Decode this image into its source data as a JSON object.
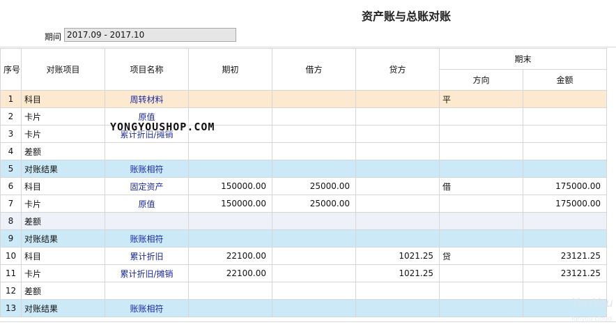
{
  "title": "资产账与总账对账",
  "period": {
    "label": "期间",
    "value": "2017.09 - 2017.10"
  },
  "columns": {
    "seq": "序号",
    "item": "对账项目",
    "name": "项目名称",
    "opening": "期初",
    "debit": "借方",
    "credit": "贷方",
    "ending": "期末",
    "direction": "方向",
    "amount": "金额"
  },
  "rows": [
    {
      "seq": "1",
      "item": "科目",
      "name": "周转材料",
      "opening": "",
      "debit": "",
      "credit": "",
      "direction": "平",
      "amount": "",
      "style": "orange"
    },
    {
      "seq": "2",
      "item": "卡片",
      "name": "原值",
      "opening": "",
      "debit": "",
      "credit": "",
      "direction": "",
      "amount": "",
      "style": ""
    },
    {
      "seq": "3",
      "item": "卡片",
      "name": "累计折旧/摊销",
      "opening": "",
      "debit": "",
      "credit": "",
      "direction": "",
      "amount": "",
      "style": ""
    },
    {
      "seq": "4",
      "item": "差额",
      "name": "",
      "opening": "",
      "debit": "",
      "credit": "",
      "direction": "",
      "amount": "",
      "style": ""
    },
    {
      "seq": "5",
      "item": "对账结果",
      "name": "账账相符",
      "opening": "",
      "debit": "",
      "credit": "",
      "direction": "",
      "amount": "",
      "style": "blue"
    },
    {
      "seq": "6",
      "item": "科目",
      "name": "固定资产",
      "opening": "150000.00",
      "debit": "25000.00",
      "credit": "",
      "direction": "借",
      "amount": "175000.00",
      "style": ""
    },
    {
      "seq": "7",
      "item": "卡片",
      "name": "原值",
      "opening": "150000.00",
      "debit": "25000.00",
      "credit": "",
      "direction": "",
      "amount": "175000.00",
      "style": ""
    },
    {
      "seq": "8",
      "item": "差额",
      "name": "",
      "opening": "",
      "debit": "",
      "credit": "",
      "direction": "",
      "amount": "",
      "style": "gray"
    },
    {
      "seq": "9",
      "item": "对账结果",
      "name": "账账相符",
      "opening": "",
      "debit": "",
      "credit": "",
      "direction": "",
      "amount": "",
      "style": "blue"
    },
    {
      "seq": "10",
      "item": "科目",
      "name": "累计折旧",
      "opening": "22100.00",
      "debit": "",
      "credit": "1021.25",
      "direction": "贷",
      "amount": "23121.25",
      "style": ""
    },
    {
      "seq": "11",
      "item": "卡片",
      "name": "累计折旧/摊销",
      "opening": "22100.00",
      "debit": "",
      "credit": "1021.25",
      "direction": "",
      "amount": "23121.25",
      "style": ""
    },
    {
      "seq": "12",
      "item": "差额",
      "name": "",
      "opening": "",
      "debit": "",
      "credit": "",
      "direction": "",
      "amount": "",
      "style": ""
    },
    {
      "seq": "13",
      "item": "对账结果",
      "name": "账账相符",
      "opening": "",
      "debit": "",
      "credit": "",
      "direction": "",
      "amount": "",
      "style": "blue"
    }
  ],
  "watermark": "YONGYOUSHOP.COM",
  "brand": "YonYou",
  "brand_sub": "Yonyou cloud"
}
